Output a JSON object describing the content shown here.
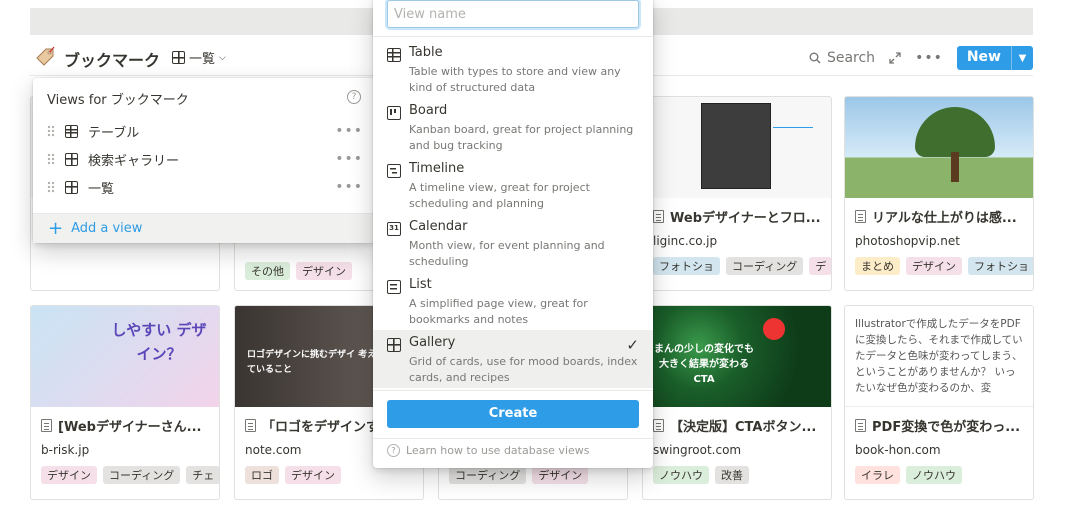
{
  "database": {
    "title": "ブックマーク",
    "current_view": "一覧",
    "search_label": "Search",
    "new_label": "New"
  },
  "views_popover": {
    "header": "Views for ブックマーク",
    "views": [
      {
        "label": "テーブル",
        "icon": "table-icon"
      },
      {
        "label": "検索ギャラリー",
        "icon": "gallery-icon"
      },
      {
        "label": "一覧",
        "icon": "gallery-icon"
      }
    ],
    "add_view_label": "Add a view"
  },
  "new_view_popover": {
    "name_placeholder": "View name",
    "options": [
      {
        "name": "Table",
        "desc": "Table with types to store and view any kind of structured data",
        "icon_char": ""
      },
      {
        "name": "Board",
        "desc": "Kanban board, great for project planning and bug tracking",
        "icon_char": ""
      },
      {
        "name": "Timeline",
        "desc": "A timeline view, great for project scheduling and planning",
        "icon_char": ""
      },
      {
        "name": "Calendar",
        "desc": "Month view, for event planning and scheduling",
        "icon_char": "31"
      },
      {
        "name": "List",
        "desc": "A simplified page view, great for bookmarks and notes",
        "icon_char": ""
      },
      {
        "name": "Gallery",
        "desc": "Grid of cards, use for mood boards, index cards, and recipes",
        "icon_char": "",
        "selected": true
      }
    ],
    "create_label": "Create",
    "learn_label": "Learn how to use database views"
  },
  "cards_row1": [
    {
      "title": "",
      "domain": "",
      "tags": []
    },
    {
      "title": "",
      "domain": "",
      "tags": [
        {
          "label": "その他",
          "color": "green"
        },
        {
          "label": "デザイン",
          "color": "pink"
        }
      ]
    },
    {
      "title": "",
      "domain": "",
      "tags": []
    },
    {
      "title": "Webデザイナーとフロ...",
      "domain": "liginc.co.jp",
      "tags": [
        {
          "label": "フォトショ",
          "color": "blue"
        },
        {
          "label": "コーディング",
          "color": "gray"
        },
        {
          "label": "デ",
          "color": "pink"
        }
      ]
    },
    {
      "title": "リアルな仕上がりは感...",
      "domain": "photoshopvip.net",
      "tags": [
        {
          "label": "まとめ",
          "color": "yellow"
        },
        {
          "label": "デザイン",
          "color": "pink"
        },
        {
          "label": "フォトショ",
          "color": "blue"
        }
      ]
    }
  ],
  "cards_row2": [
    {
      "title": "[Webデザイナーさん...",
      "domain": "b-risk.jp",
      "image_text": "しやすい デザイン？",
      "tags": [
        {
          "label": "デザイン",
          "color": "pink"
        },
        {
          "label": "コーディング",
          "color": "gray"
        },
        {
          "label": "チェ",
          "color": "gray"
        }
      ]
    },
    {
      "title": "「ロゴをデザインす",
      "domain": "note.com",
      "image_text": "ロゴデザインに挑むデザイ 考えていること",
      "tags": [
        {
          "label": "ロゴ",
          "color": "brown"
        },
        {
          "label": "デザイン",
          "color": "pink"
        }
      ]
    },
    {
      "title": "",
      "domain": "",
      "tags": [
        {
          "label": "コーディング",
          "color": "gray"
        },
        {
          "label": "デザイン",
          "color": "pink"
        }
      ]
    },
    {
      "title": "【決定版】CTAボタン...",
      "domain": "swingroot.com",
      "image_text": "まんの少しの変化でも 大きく結果が変わる CTA",
      "tags": [
        {
          "label": "ノウハウ",
          "color": "green"
        },
        {
          "label": "改善",
          "color": "gray"
        }
      ]
    },
    {
      "title": "PDF変換で色が変わっ...",
      "domain": "book-hon.com",
      "preview": "Illustratorで作成したデータをPDFに変換したら、それまで作成していたデータと色味が変わってしまう、ということがありませんか？ いったいなぜ色が変わるのか、変",
      "tags": [
        {
          "label": "イラレ",
          "color": "orange"
        },
        {
          "label": "ノウハウ",
          "color": "green"
        }
      ]
    }
  ],
  "colors": {
    "accent": "#2e9ce6",
    "text": "#37352f",
    "muted": "#787774"
  }
}
